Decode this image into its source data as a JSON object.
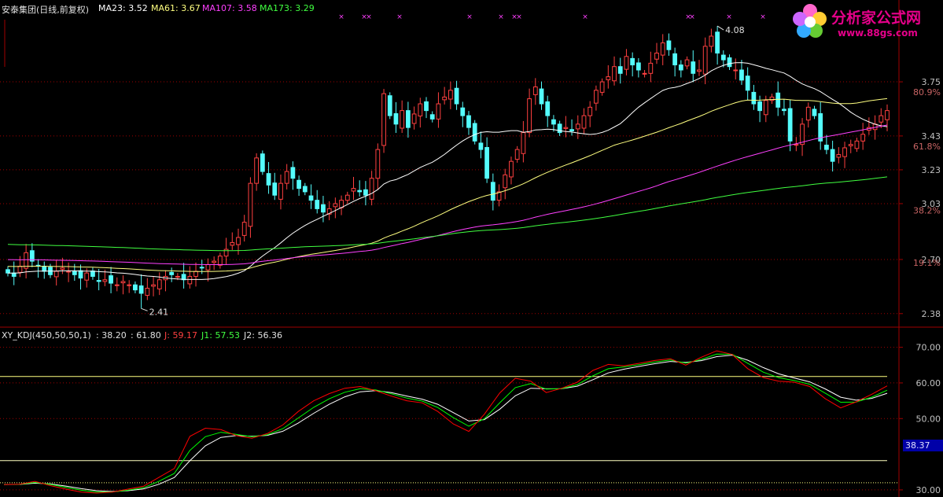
{
  "main_header": {
    "name": "安泰集团(日线,前复权)",
    "ma23": "MA23: 3.52",
    "ma61": "MA61: 3.67",
    "ma107": "MA107: 3.58",
    "ma173": "MA173: 3.29"
  },
  "kdj_header": {
    "name": "XY_KDJ(450,50,50,1)",
    "v1": ": 38.20",
    "v2": ": 61.80",
    "j": "J: 59.17",
    "j1": "J1: 57.53",
    "j2": "J2: 56.36"
  },
  "logo": {
    "title": "分析家公式网",
    "url": "www.88gs.com"
  },
  "annotations": {
    "high": "4.08",
    "low": "2.41"
  },
  "kdj_badge": "38.37",
  "colors": {
    "up": "#ff4040",
    "down": "#54fcfc",
    "ma23": "#ffffff",
    "ma61": "#ffff80",
    "ma107": "#ff40ff",
    "ma173": "#40ff40",
    "grid": "#a00000",
    "label": "#c0c0c0",
    "kdj_k": "#ffffff",
    "kdj_d": "#ffff00",
    "kdj_j": "#ff0000",
    "kdj_j1": "#00ff00"
  },
  "chart_data": [
    {
      "type": "candlestick",
      "title": "安泰集团(日线,前复权)",
      "ylim": [
        2.3,
        4.15
      ],
      "price_ticks": [
        "3.75",
        "3.43",
        "3.23",
        "3.03",
        "2.70",
        "2.38"
      ],
      "percent_ticks": [
        {
          "label": "80.9%",
          "value": 3.69
        },
        {
          "label": "61.8%",
          "value": 3.37
        },
        {
          "label": "38.2%",
          "value": 2.99
        },
        {
          "label": "19.1%",
          "value": 2.68
        }
      ],
      "max_price": 4.08,
      "min_price": 2.41,
      "series": [
        {
          "name": "MA23",
          "value": 3.52
        },
        {
          "name": "MA61",
          "value": 3.67
        },
        {
          "name": "MA107",
          "value": 3.58
        },
        {
          "name": "MA173",
          "value": 3.29
        }
      ],
      "close": [
        2.62,
        2.6,
        2.66,
        2.74,
        2.69,
        2.66,
        2.63,
        2.61,
        2.63,
        2.65,
        2.63,
        2.61,
        2.59,
        2.62,
        2.6,
        2.57,
        2.58,
        2.56,
        2.55,
        2.57,
        2.55,
        2.52,
        2.5,
        2.53,
        2.55,
        2.58,
        2.6,
        2.61,
        2.6,
        2.58,
        2.6,
        2.63,
        2.65,
        2.67,
        2.69,
        2.72,
        2.76,
        2.8,
        2.83,
        2.92,
        3.15,
        3.3,
        3.22,
        3.14,
        3.08,
        3.15,
        3.22,
        3.18,
        3.12,
        3.1,
        3.05,
        3.0,
        2.98,
        3.0,
        3.03,
        3.05,
        3.08,
        3.12,
        3.1,
        3.08,
        3.18,
        3.35,
        3.68,
        3.55,
        3.5,
        3.58,
        3.48,
        3.56,
        3.62,
        3.58,
        3.53,
        3.62,
        3.66,
        3.7,
        3.62,
        3.55,
        3.48,
        3.4,
        3.35,
        3.18,
        3.05,
        3.1,
        3.2,
        3.28,
        3.35,
        3.45,
        3.65,
        3.72,
        3.62,
        3.55,
        3.5,
        3.45,
        3.48,
        3.46,
        3.5,
        3.55,
        3.6,
        3.7,
        3.75,
        3.78,
        3.84,
        3.8,
        3.9,
        3.85,
        3.82,
        3.8,
        3.86,
        3.92,
        3.98,
        3.94,
        3.85,
        3.82,
        3.88,
        3.8,
        3.82,
        3.96,
        4.02,
        3.92,
        3.88,
        3.84,
        3.82,
        3.76,
        3.7,
        3.62,
        3.58,
        3.64,
        3.66,
        3.6,
        3.58,
        3.4,
        3.38,
        3.5,
        3.6,
        3.55,
        3.4,
        3.35,
        3.28,
        3.32,
        3.36,
        3.38,
        3.4,
        3.44,
        3.48,
        3.5,
        3.55,
        3.58
      ]
    },
    {
      "type": "line",
      "title": "XY_KDJ(450,50,50,1)",
      "ylim": [
        28,
        73
      ],
      "y_ticks": [
        "70.00",
        "60.00",
        "50.00",
        "30.00"
      ],
      "reference_lines": [
        61.8,
        38.2,
        32.0
      ],
      "series": [
        {
          "name": "J",
          "value": 59.17
        },
        {
          "name": "J1",
          "value": 57.53
        },
        {
          "name": "J2",
          "value": 56.36
        }
      ],
      "j_values": [
        31.5,
        31.6,
        32.4,
        31.2,
        30.2,
        29.4,
        29.1,
        29.4,
        30.2,
        31.0,
        33.5,
        36.0,
        45.0,
        47.3,
        46.9,
        45.2,
        44.5,
        45.8,
        48.2,
        52.0,
        55.0,
        57.0,
        58.5,
        59.0,
        57.8,
        56.3,
        55.0,
        54.4,
        52.0,
        48.5,
        46.4,
        51.2,
        57.2,
        61.3,
        60.5,
        57.3,
        58.5,
        60.2,
        63.5,
        65.2,
        64.8,
        65.5,
        66.3,
        66.8,
        65.0,
        67.2,
        69.0,
        68.0,
        64.0,
        61.5,
        60.5,
        60.2,
        59.0,
        55.6,
        53.0,
        54.7,
        56.8,
        59.17
      ]
    }
  ]
}
